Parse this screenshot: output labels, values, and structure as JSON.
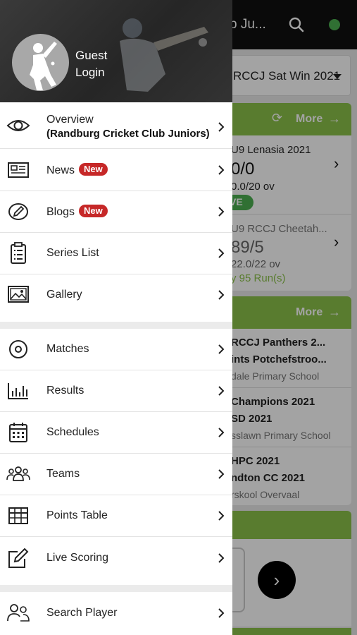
{
  "background": {
    "title": "b Ju...",
    "series_select": "RCCJ Sat Win 2021",
    "card1": {
      "more_label": "More",
      "matches": [
        {
          "name": "U9 Lenasia 2021",
          "score": "0/0",
          "overs": "0.0/20 ov",
          "status": "VE"
        },
        {
          "name": "U9 RCCJ Cheetah...",
          "score": "89/5",
          "overs": "22.0/22 ov",
          "result": "y 95 Run(s)"
        }
      ]
    },
    "card2": {
      "more_label": "More",
      "fixtures": [
        {
          "team1": "RCCJ Panthers 2...",
          "team2": "ints Potchefstroo...",
          "venue": "dale Primary School"
        },
        {
          "team1": "Champions 2021",
          "team2": "SD 2021",
          "venue": "sslawn Primary School"
        },
        {
          "team1": "HPC 2021",
          "team2": "ndton CC 2021",
          "venue": "rskool Overvaal"
        }
      ]
    }
  },
  "drawer": {
    "user": {
      "guest": "Guest",
      "login": "Login"
    },
    "items": [
      {
        "label": "Overview",
        "sub": "(Randburg Cricket Club Juniors)",
        "icon": "eye-icon"
      },
      {
        "label": "News",
        "badge": "New",
        "icon": "newspaper-icon"
      },
      {
        "label": "Blogs",
        "badge": "New",
        "icon": "pen-icon"
      },
      {
        "label": "Series List",
        "icon": "clipboard-list-icon"
      },
      {
        "label": "Gallery",
        "icon": "gallery-icon"
      },
      {
        "label": "Matches",
        "icon": "target-icon"
      },
      {
        "label": "Results",
        "icon": "bar-chart-icon"
      },
      {
        "label": "Schedules",
        "icon": "calendar-icon"
      },
      {
        "label": "Teams",
        "icon": "team-icon"
      },
      {
        "label": "Points Table",
        "icon": "table-icon"
      },
      {
        "label": "Live Scoring",
        "icon": "edit-icon"
      },
      {
        "label": "Search Player",
        "icon": "search-player-icon"
      }
    ]
  },
  "colors": {
    "accent_green": "#8bc34a",
    "badge_red": "#c62828",
    "live_green": "#4caf50"
  }
}
